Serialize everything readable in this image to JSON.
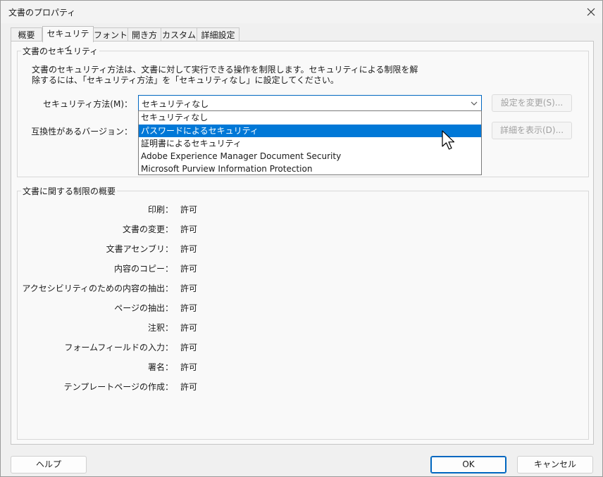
{
  "window": {
    "title": "文書のプロパティ"
  },
  "tabs": [
    {
      "label": "概要"
    },
    {
      "label": "セキュリティ"
    },
    {
      "label": "フォント"
    },
    {
      "label": "開き方"
    },
    {
      "label": "カスタム"
    },
    {
      "label": "詳細設定"
    }
  ],
  "security": {
    "group_title": "文書のセキュリティ",
    "description_line1": "文書のセキュリティ方法は、文書に対して実行できる操作を制限します。セキュリティによる制限を解",
    "description_line2": "除するには、「セキュリティ方法」を「セキュリティなし」に設定してください。",
    "method_label": "セキュリティ方法(M)：",
    "method_value": "セキュリティなし",
    "compat_label": "互換性があるバージョン：",
    "change_settings_button": "設定を変更(S)...",
    "show_details_button": "詳細を表示(D)...",
    "dropdown_options": [
      "セキュリティなし",
      "パスワードによるセキュリティ",
      "証明書によるセキュリティ",
      "Adobe Experience Manager Document Security",
      "Microsoft Purview Information Protection"
    ],
    "selected_option_index": 1
  },
  "summary": {
    "group_title": "文書に関する制限の概要",
    "rows": [
      {
        "label": "印刷：",
        "value": "許可"
      },
      {
        "label": "文書の変更：",
        "value": "許可"
      },
      {
        "label": "文書アセンブリ：",
        "value": "許可"
      },
      {
        "label": "内容のコピー：",
        "value": "許可"
      },
      {
        "label": "アクセシビリティのための内容の抽出：",
        "value": "許可"
      },
      {
        "label": "ページの抽出：",
        "value": "許可"
      },
      {
        "label": "注釈：",
        "value": "許可"
      },
      {
        "label": "フォームフィールドの入力：",
        "value": "許可"
      },
      {
        "label": "署名：",
        "value": "許可"
      },
      {
        "label": "テンプレートページの作成：",
        "value": "許可"
      }
    ]
  },
  "footer": {
    "help_button": "ヘルプ",
    "ok_button": "OK",
    "cancel_button": "キャンセル"
  },
  "colors": {
    "accent": "#0078d7",
    "focus_border": "#0067c0"
  }
}
